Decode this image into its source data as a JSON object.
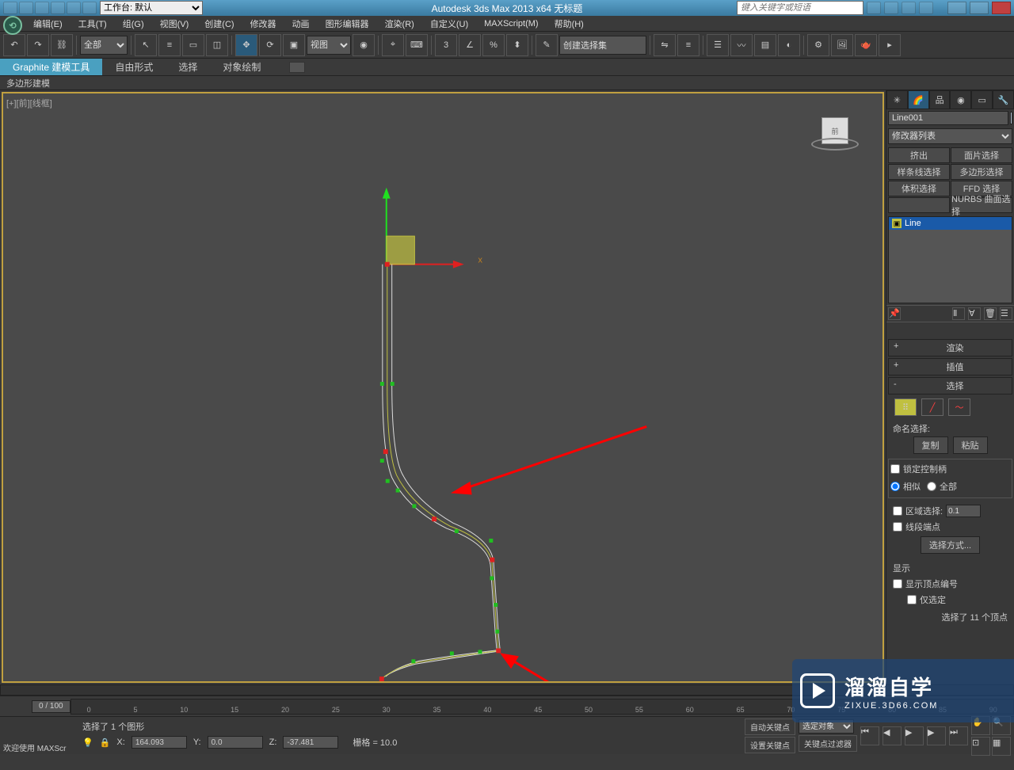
{
  "title": "Autodesk 3ds Max  2013 x64       无标题",
  "workspace_label": "工作台: 默认",
  "search_placeholder": "键入关键字或短语",
  "menu": [
    "编辑(E)",
    "工具(T)",
    "组(G)",
    "视图(V)",
    "创建(C)",
    "修改器",
    "动画",
    "图形编辑器",
    "渲染(R)",
    "自定义(U)",
    "MAXScript(M)",
    "帮助(H)"
  ],
  "toolbar": {
    "filter": "全部",
    "ref_coord": "视图",
    "named_sel": "创建选择集"
  },
  "ribbon": {
    "tabs": [
      "Graphite 建模工具",
      "自由形式",
      "选择",
      "对象绘制"
    ],
    "sub": "多边形建模"
  },
  "viewport": {
    "label": "[+][前][线框]",
    "view_cube": "前"
  },
  "command_panel": {
    "object_name": "Line001",
    "modifier_list": "修改器列表",
    "modifier_buttons": [
      "挤出",
      "面片选择",
      "样条线选择",
      "多边形选择",
      "体积选择",
      "FFD 选择",
      "",
      "NURBS 曲面选择"
    ],
    "stack_item": "Line",
    "rollouts": {
      "render": "渲染",
      "interp": "插值",
      "selection": "选择"
    },
    "named_sel_label": "命名选择:",
    "copy": "复制",
    "paste": "粘贴",
    "lock_handles": "锁定控制柄",
    "alike": "相似",
    "all": "全部",
    "area_sel": "区域选择:",
    "area_val": "0.1",
    "seg_end": "线段端点",
    "sel_method": "选择方式...",
    "display": "显示",
    "show_vert_num": "显示顶点编号",
    "only_sel": "仅选定",
    "sel_count": "选择了 11 个顶点"
  },
  "timeline": {
    "frame": "0 / 100",
    "ticks": [
      "0",
      "5",
      "10",
      "15",
      "20",
      "25",
      "30",
      "35",
      "40",
      "45",
      "50",
      "55",
      "60",
      "65",
      "70",
      "75",
      "80",
      "85",
      "90"
    ]
  },
  "status": {
    "welcome": "欢迎使用 MAXScr",
    "selection": "选择了 1 个图形",
    "x": "164.093",
    "y": "0.0",
    "z": "-37.481",
    "grid": "栅格 = 10.0",
    "auto_key": "自动关键点",
    "sel_obj": "选定对象",
    "set_key": "设置关键点",
    "key_filters": "关键点过滤器"
  },
  "watermark": {
    "main": "溜溜自学",
    "sub": "ZIXUE.3D66.COM"
  }
}
